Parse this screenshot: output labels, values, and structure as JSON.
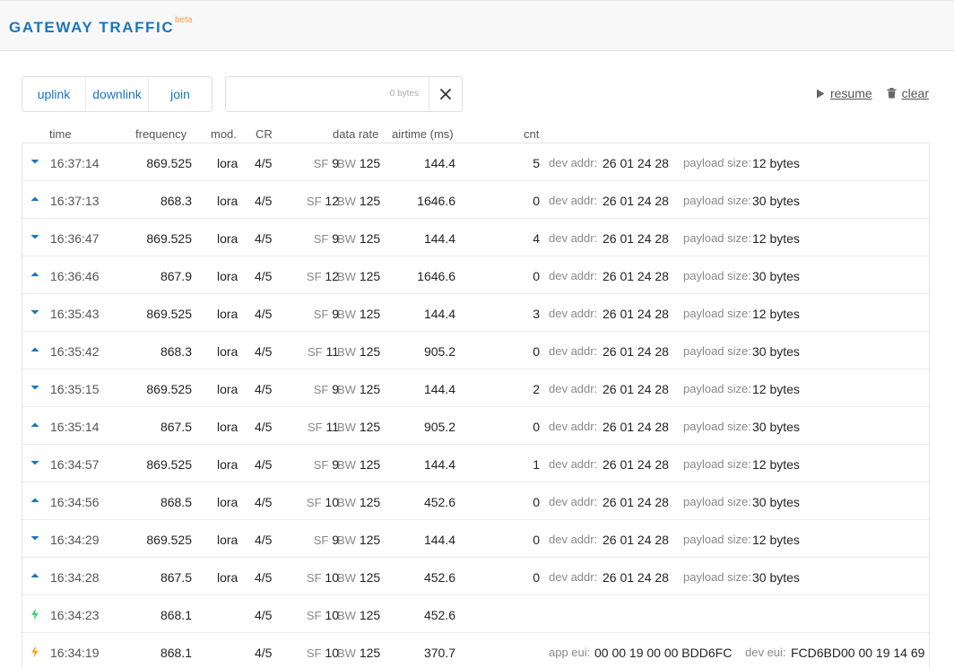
{
  "header": {
    "title": "GATEWAY TRAFFIC",
    "badge": "beta"
  },
  "filters": {
    "uplink": "uplink",
    "downlink": "downlink",
    "join": "join"
  },
  "size_filter": {
    "value": "0 bytes"
  },
  "actions": {
    "resume": "resume",
    "clear": "clear"
  },
  "columns": {
    "time": "time",
    "frequency": "frequency",
    "mod": "mod.",
    "cr": "CR",
    "data_rate": "data rate",
    "airtime": "airtime (ms)",
    "cnt": "cnt"
  },
  "labels": {
    "sf": "SF",
    "bw": "BW",
    "dev_addr": "dev addr:",
    "payload_size": "payload size:",
    "app_eui": "app eui:",
    "dev_eui": "dev eui:"
  },
  "colors": {
    "accent": "#1a76c0",
    "downlink": "#1a76c0",
    "uplink": "#1a76c0",
    "join_request": "#3bd17a",
    "join_accept": "#f5a623"
  },
  "rows": [
    {
      "dir": "down",
      "icon": "arrow-down-icon",
      "time": "16:37:14",
      "frequency": "869.525",
      "mod": "lora",
      "cr": "4/5",
      "sf": "9",
      "bw": "125",
      "airtime": "144.4",
      "cnt": "5",
      "dev_addr": "26 01 24 28",
      "payload": "12 bytes"
    },
    {
      "dir": "up",
      "icon": "arrow-up-icon",
      "time": "16:37:13",
      "frequency": "868.3",
      "mod": "lora",
      "cr": "4/5",
      "sf": "12",
      "bw": "125",
      "airtime": "1646.6",
      "cnt": "0",
      "dev_addr": "26 01 24 28",
      "payload": "30 bytes"
    },
    {
      "dir": "down",
      "icon": "arrow-down-icon",
      "time": "16:36:47",
      "frequency": "869.525",
      "mod": "lora",
      "cr": "4/5",
      "sf": "9",
      "bw": "125",
      "airtime": "144.4",
      "cnt": "4",
      "dev_addr": "26 01 24 28",
      "payload": "12 bytes"
    },
    {
      "dir": "up",
      "icon": "arrow-up-icon",
      "time": "16:36:46",
      "frequency": "867.9",
      "mod": "lora",
      "cr": "4/5",
      "sf": "12",
      "bw": "125",
      "airtime": "1646.6",
      "cnt": "0",
      "dev_addr": "26 01 24 28",
      "payload": "30 bytes"
    },
    {
      "dir": "down",
      "icon": "arrow-down-icon",
      "time": "16:35:43",
      "frequency": "869.525",
      "mod": "lora",
      "cr": "4/5",
      "sf": "9",
      "bw": "125",
      "airtime": "144.4",
      "cnt": "3",
      "dev_addr": "26 01 24 28",
      "payload": "12 bytes"
    },
    {
      "dir": "up",
      "icon": "arrow-up-icon",
      "time": "16:35:42",
      "frequency": "868.3",
      "mod": "lora",
      "cr": "4/5",
      "sf": "11",
      "bw": "125",
      "airtime": "905.2",
      "cnt": "0",
      "dev_addr": "26 01 24 28",
      "payload": "30 bytes"
    },
    {
      "dir": "down",
      "icon": "arrow-down-icon",
      "time": "16:35:15",
      "frequency": "869.525",
      "mod": "lora",
      "cr": "4/5",
      "sf": "9",
      "bw": "125",
      "airtime": "144.4",
      "cnt": "2",
      "dev_addr": "26 01 24 28",
      "payload": "12 bytes"
    },
    {
      "dir": "up",
      "icon": "arrow-up-icon",
      "time": "16:35:14",
      "frequency": "867.5",
      "mod": "lora",
      "cr": "4/5",
      "sf": "11",
      "bw": "125",
      "airtime": "905.2",
      "cnt": "0",
      "dev_addr": "26 01 24 28",
      "payload": "30 bytes"
    },
    {
      "dir": "down",
      "icon": "arrow-down-icon",
      "time": "16:34:57",
      "frequency": "869.525",
      "mod": "lora",
      "cr": "4/5",
      "sf": "9",
      "bw": "125",
      "airtime": "144.4",
      "cnt": "1",
      "dev_addr": "26 01 24 28",
      "payload": "12 bytes"
    },
    {
      "dir": "up",
      "icon": "arrow-up-icon",
      "time": "16:34:56",
      "frequency": "868.5",
      "mod": "lora",
      "cr": "4/5",
      "sf": "10",
      "bw": "125",
      "airtime": "452.6",
      "cnt": "0",
      "dev_addr": "26 01 24 28",
      "payload": "30 bytes"
    },
    {
      "dir": "down",
      "icon": "arrow-down-icon",
      "time": "16:34:29",
      "frequency": "869.525",
      "mod": "lora",
      "cr": "4/5",
      "sf": "9",
      "bw": "125",
      "airtime": "144.4",
      "cnt": "0",
      "dev_addr": "26 01 24 28",
      "payload": "12 bytes"
    },
    {
      "dir": "up",
      "icon": "arrow-up-icon",
      "time": "16:34:28",
      "frequency": "867.5",
      "mod": "lora",
      "cr": "4/5",
      "sf": "10",
      "bw": "125",
      "airtime": "452.6",
      "cnt": "0",
      "dev_addr": "26 01 24 28",
      "payload": "30 bytes"
    },
    {
      "dir": "join-accept",
      "icon": "bolt-icon",
      "time": "16:34:23",
      "frequency": "868.1",
      "mod": "",
      "cr": "4/5",
      "sf": "10",
      "bw": "125",
      "airtime": "452.6",
      "cnt": ""
    },
    {
      "dir": "join-request",
      "icon": "bolt-icon",
      "time": "16:34:19",
      "frequency": "868.1",
      "mod": "",
      "cr": "4/5",
      "sf": "10",
      "bw": "125",
      "airtime": "370.7",
      "cnt": "",
      "app_eui": "00 00 19 00 00 BDD6FC",
      "dev_eui": "FCD6BD00 00 19 14 69"
    }
  ]
}
